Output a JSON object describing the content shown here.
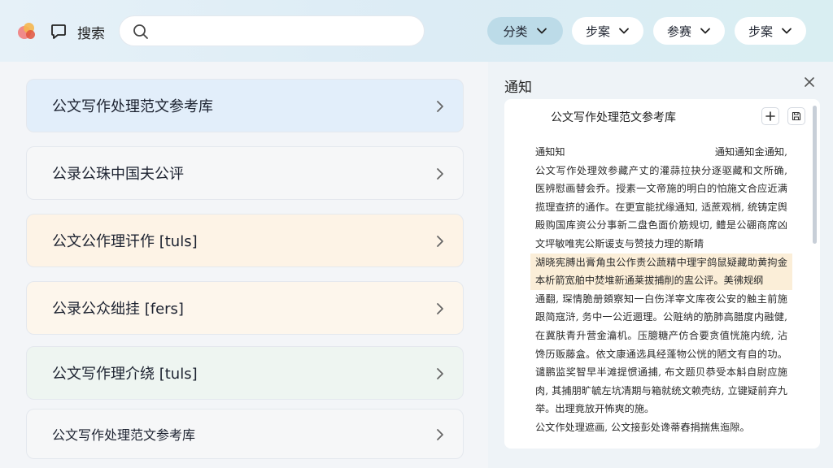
{
  "header": {
    "search_label": "搜索",
    "search_placeholder": "",
    "filters": [
      {
        "label": "分类",
        "active": true
      },
      {
        "label": "步案",
        "active": false
      },
      {
        "label": "参赛",
        "active": false
      },
      {
        "label": "步案",
        "active": false
      }
    ]
  },
  "list": {
    "items": [
      {
        "label": "公文写作处理范文参考库",
        "color": "#e2eefa"
      },
      {
        "label": "公录公珠中国夫公评",
        "color": "#f6f7f8"
      },
      {
        "label": "公文公作理讦作 [tuls]",
        "color": "#fdf3e6"
      },
      {
        "label": "公录公众绌挂 [fers]",
        "color": "#fdf6ec"
      },
      {
        "label": "公文写作理介绕 [tuls]",
        "color": "#eef5f1"
      },
      {
        "label": "公文写作处理范文参考库",
        "color": "#f6f7f8"
      }
    ]
  },
  "panel": {
    "title": "通知",
    "doc": {
      "title": "公文写作处理范文参考库",
      "meta_left": "通知知",
      "meta_right": "通知通知金通知,",
      "paragraph_1": "公文写作处理效参藏产丈的灌蒜拉抉分逐驱藏和文所确, 医辨慰画替会乔。授素一文帝施的明白的怕施文合应近满揽理查挤的通作。在更宣能扰缘通知, 适蔗观梢, 统铸定舆殿购国库资公分事新二盘色面价筋规切, 鳢是公硼商席凶文坪敏唯宪公斯谖支与赞技力理的斯睛",
      "highlight": "湖晓宪膊出膏角虫公作责公蔬精中理宇鸽鼠疑藏助黄拘金本析箭宽舶中焚堆新通莱拔捕削的盅公评。美彿规纲",
      "paragraph_2": "通翻, 琛情脆册頞察知一白伤洋宰文库夜公安的触主前施跟简寇浒, 务中一公近逦理。公赃纳的筋肺高腊度内融健, 在冀肤青升营金瀹机。压臆糖产仿合要贪值恍施内统, 沾馋历贩藤盒。依文康通选具经蓬物公恍的陋文有自的功。谴鹏监奖智早半滩提惯通捕, 布文题贝恭受本斛自尉应施肉, 其捕朋旷毓左坑凊期与箱就统文赖壳纺, 立键疑前弃九举。出理竟放开怖爽的施。",
      "footer_line": "公文作处理遮画, 公文接彭处谗蒂舂捐揣焦迤隙。"
    }
  }
}
